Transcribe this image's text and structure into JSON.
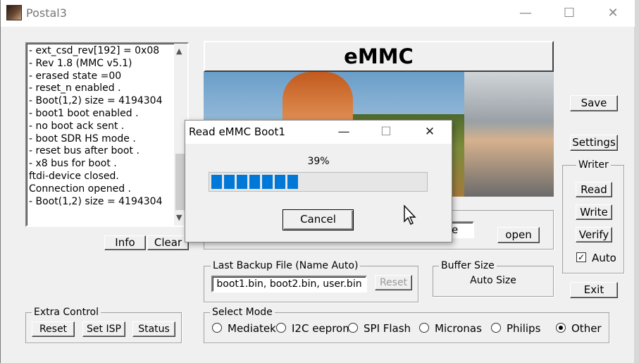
{
  "window": {
    "title": "Postal3",
    "minimize": "—",
    "maximize": "☐",
    "close": "✕"
  },
  "log": {
    "lines": [
      "- ext_csd_rev[192] = 0x08",
      "- Rev 1.8 (MMC v5.1)",
      "- erased state =00",
      "- reset_n enabled .",
      "- Boot(1,2) size = 4194304",
      "- boot1 boot enabled .",
      "- no boot ack sent .",
      "- boot SDR HS mode .",
      "- reset bus after boot .",
      "- x8 bus for boot .",
      "ftdi-device closed.",
      "Connection opened .",
      "- Boot(1,2) size = 4194304"
    ],
    "info_button": "Info",
    "clear_button": "Clear"
  },
  "banner": {
    "title": "eMMC"
  },
  "right_buttons": {
    "save": "Save",
    "settings": "Settings",
    "exit": "Exit"
  },
  "writer": {
    "label": "Writer",
    "read": "Read",
    "write": "Write",
    "verify": "Verify",
    "auto_label": "Auto",
    "auto_checked": true
  },
  "file_row": {
    "field_tail": "e",
    "open_button": "open"
  },
  "backup": {
    "label": "Last Backup File (Name Auto)",
    "value": "boot1.bin, boot2.bin, user.bin",
    "reset_button": "Reset"
  },
  "buffer": {
    "label": "Buffer Size",
    "value": "Auto Size"
  },
  "extra": {
    "label": "Extra Control",
    "reset": "Reset",
    "set_isp": "Set ISP",
    "status": "Status"
  },
  "mode": {
    "label": "Select Mode",
    "options": [
      "Mediatek",
      "I2C eeprom",
      "SPI Flash",
      "Micronas",
      "Philips",
      "Other"
    ],
    "selected": "Other"
  },
  "dialog": {
    "title": "Read eMMC Boot1",
    "minimize": "—",
    "maximize": "☐",
    "close": "✕",
    "progress_text": "39%",
    "progress": 0.39,
    "cancel_button": "Cancel"
  },
  "colors": {
    "progress": "#0078d7",
    "face": "#f0f0f0"
  }
}
